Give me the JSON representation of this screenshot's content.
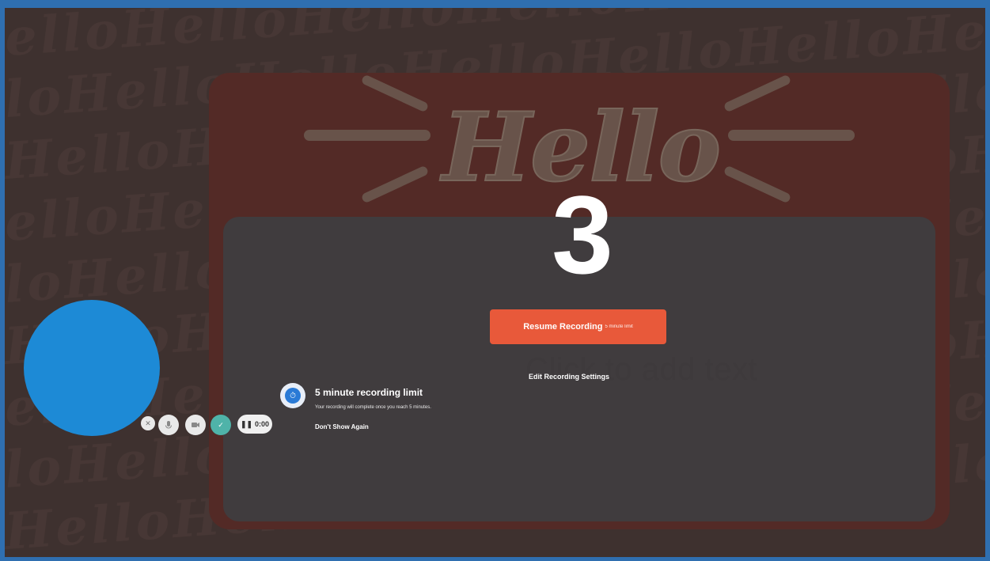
{
  "slide": {
    "title_art": "Hello",
    "placeholder": "Click to add text"
  },
  "recording": {
    "countdown": "3",
    "resume_label": "Resume Recording",
    "resume_sublabel": "5 minute limit",
    "edit_settings_label": "Edit Recording Settings"
  },
  "camera_controls": {
    "duration": "0:00"
  },
  "tip": {
    "title": "5 minute recording limit",
    "body": "Your recording will complete once you reach 5 minutes.",
    "dismiss_label": "Don't Show Again"
  },
  "colors": {
    "accent": "#e8593a",
    "camera_bubble": "#1d8ad6",
    "check": "#4fb3a9"
  },
  "icons": [
    "timer-icon",
    "microphone-icon",
    "camera-icon",
    "check-icon",
    "pause-icon"
  ]
}
